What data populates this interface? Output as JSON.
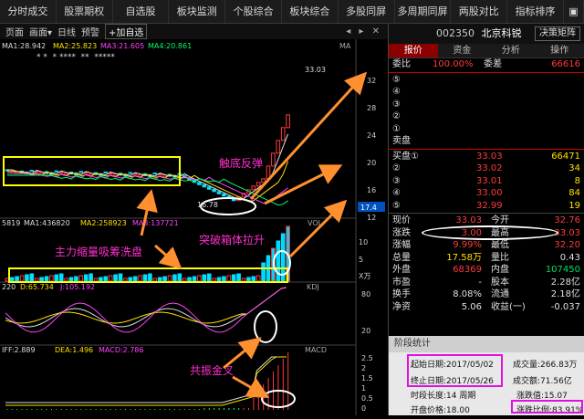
{
  "topbar": {
    "tabs": [
      "分时成交",
      "股票期权",
      "自选股",
      "板块监测",
      "个股综合",
      "板块综合",
      "多股同屏",
      "多周期同屏",
      "两股对比",
      "指标排序"
    ],
    "more": "▣"
  },
  "toolbar": {
    "left": "页面",
    "draw": "画面▾",
    "period": "日线",
    "preset": "预警",
    "add": "+加自选",
    "nav": "◂ ▸ ✕"
  },
  "ma_legend": {
    "ma1": "MA1:28.942",
    "ma2": "MA2:25.823",
    "ma3": "MA3:21.605",
    "ma4": "MA4:20.861",
    "label": "MA"
  },
  "stars": "* *  * ****  **  *****",
  "price_axis": [
    "32",
    "28",
    "24",
    "20",
    "16",
    "12"
  ],
  "price_labels": {
    "high": "33.03",
    "low": "16.78",
    "current": "17.4"
  },
  "vol_legend": {
    "v": "5819",
    "ma1": "MA1:436820",
    "ma2": "MA2:258923",
    "ma3": "MA3:137721",
    "label": "VOL",
    "unit": "X万",
    "axis": [
      "10",
      "5"
    ]
  },
  "kdj_legend": {
    "k": "220",
    "d": "D:65.734",
    "j": "J:105.192",
    "label": "KDJ",
    "axis": [
      "80",
      "20"
    ]
  },
  "macd_legend": {
    "dif": "IFF:2.889",
    "dea": "DEA:1.496",
    "macd": "MACD:2.786",
    "label": "MACD",
    "axis": [
      "2.5",
      "2",
      "1.5",
      "1",
      "0.5",
      "0"
    ]
  },
  "annotations": {
    "bottom_rebound": "触底反弹",
    "box_breakout": "突破箱体拉升",
    "accumulate": "主力缩量吸筹洗盘",
    "golden_cross": "共振金叉"
  },
  "colors": {
    "up": "#ff3b3b",
    "down": "#00e0ff",
    "annotation": "#ff2fd0",
    "arrow": "#ff9030",
    "box": "#ffff00"
  },
  "stock": {
    "code": "002350",
    "name": "北京科锐",
    "button": "决策矩阵"
  },
  "tabs": [
    "报价",
    "资金",
    "分析",
    "操作"
  ],
  "order_book": {
    "weibi_label": "委比",
    "weibi_value": "100.00%",
    "weicha_label": "委差",
    "weicha_value": "66616",
    "asks": [
      "⑤",
      "④",
      "③",
      "②",
      "①"
    ],
    "ask_label": "卖盘",
    "bids": [
      {
        "l": "买盘①",
        "p": "33.03",
        "v": "66471"
      },
      {
        "l": "②",
        "p": "33.02",
        "v": "34"
      },
      {
        "l": "③",
        "p": "33.01",
        "v": "8"
      },
      {
        "l": "④",
        "p": "33.00",
        "v": "84"
      },
      {
        "l": "⑤",
        "p": "32.99",
        "v": "19"
      }
    ]
  },
  "quotes": [
    {
      "l1": "现价",
      "v1": "33.03",
      "l2": "今开",
      "v2": "32.76"
    },
    {
      "l1": "涨跌",
      "v1": "3.00",
      "l2": "最高",
      "v2": "33.03"
    },
    {
      "l1": "涨幅",
      "v1": "9.99%",
      "l2": "最低",
      "v2": "32.20"
    },
    {
      "l1": "总量",
      "v1": "17.58万",
      "l2": "量比",
      "v2": "0.43"
    },
    {
      "l1": "外盘",
      "v1": "68369",
      "l2": "内盘",
      "v2": "107450"
    },
    {
      "l1": "市盈",
      "v1": "-",
      "l2": "股本",
      "v2": "2.28亿"
    },
    {
      "l1": "换手",
      "v1": "8.08%",
      "l2": "流通",
      "v2": "2.18亿"
    },
    {
      "l1": "净资",
      "v1": "5.06",
      "l2": "收益(一)",
      "v2": "-0.037"
    }
  ],
  "stats": {
    "title": "阶段统计",
    "start": "起始日期:2017/05/02",
    "end": "终止日期:2017/05/26",
    "span": "时段长度:14 周期",
    "open": "开盘价格:18.00",
    "amount": "成交量:266.83万",
    "value": "成交额:71.56亿",
    "rise": "涨跌值:15.07",
    "pct": "涨跌比例:83.91%"
  }
}
